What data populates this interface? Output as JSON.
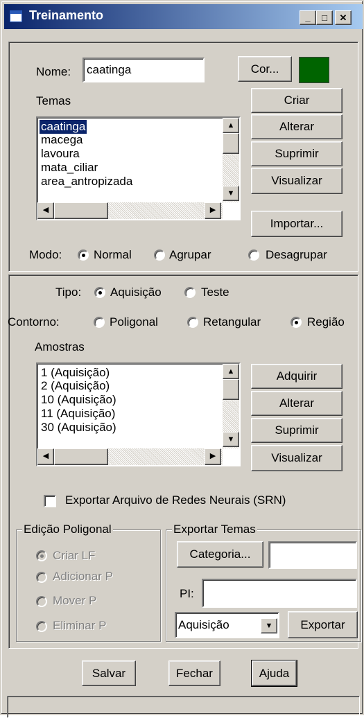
{
  "window": {
    "title": "Treinamento",
    "min_glyph": "_",
    "max_glyph": "□",
    "close_glyph": "✕"
  },
  "top": {
    "nome_label": "Nome:",
    "nome_value": "caatinga",
    "cor_button": "Cor...",
    "color_swatch": "#006400",
    "temas_label": "Temas",
    "temas": [
      "caatinga",
      "macega",
      "lavoura",
      "mata_ciliar",
      "area_antropizada"
    ],
    "selected_index": 0,
    "buttons": {
      "criar": "Criar",
      "alterar": "Alterar",
      "suprimir": "Suprimir",
      "visualizar": "Visualizar",
      "importar": "Importar..."
    },
    "modo_label": "Modo:",
    "modo_options": [
      "Normal",
      "Agrupar",
      "Desagrupar"
    ],
    "modo_selected": "Normal"
  },
  "middle": {
    "tipo_label": "Tipo:",
    "tipo_options": [
      "Aquisição",
      "Teste"
    ],
    "tipo_selected": "Aquisição",
    "contorno_label": "Contorno:",
    "contorno_options": [
      "Poligonal",
      "Retangular",
      "Região"
    ],
    "contorno_selected": "Região",
    "amostras_label": "Amostras",
    "amostras": [
      "1 (Aquisição)",
      "2 (Aquisição)",
      "10 (Aquisição)",
      "11 (Aquisição)",
      "30 (Aquisição)"
    ],
    "buttons": {
      "adquirir": "Adquirir",
      "alterar": "Alterar",
      "suprimir": "Suprimir",
      "visualizar": "Visualizar"
    },
    "exportar_srn_label": "Exportar Arquivo de Redes Neurais (SRN)",
    "exportar_srn_checked": false,
    "edicao": {
      "title": "Edição Poligonal",
      "options": [
        "Criar LF",
        "Adicionar P",
        "Mover P",
        "Eliminar P"
      ],
      "selected": "Criar LF"
    },
    "exportar_temas": {
      "title": "Exportar Temas",
      "categoria_button": "Categoria...",
      "categoria_value": "",
      "pi_label": "PI:",
      "pi_value": "",
      "tipo_value": "Aquisição",
      "exportar_button": "Exportar"
    }
  },
  "footer": {
    "salvar": "Salvar",
    "fechar": "Fechar",
    "ajuda": "Ajuda"
  }
}
